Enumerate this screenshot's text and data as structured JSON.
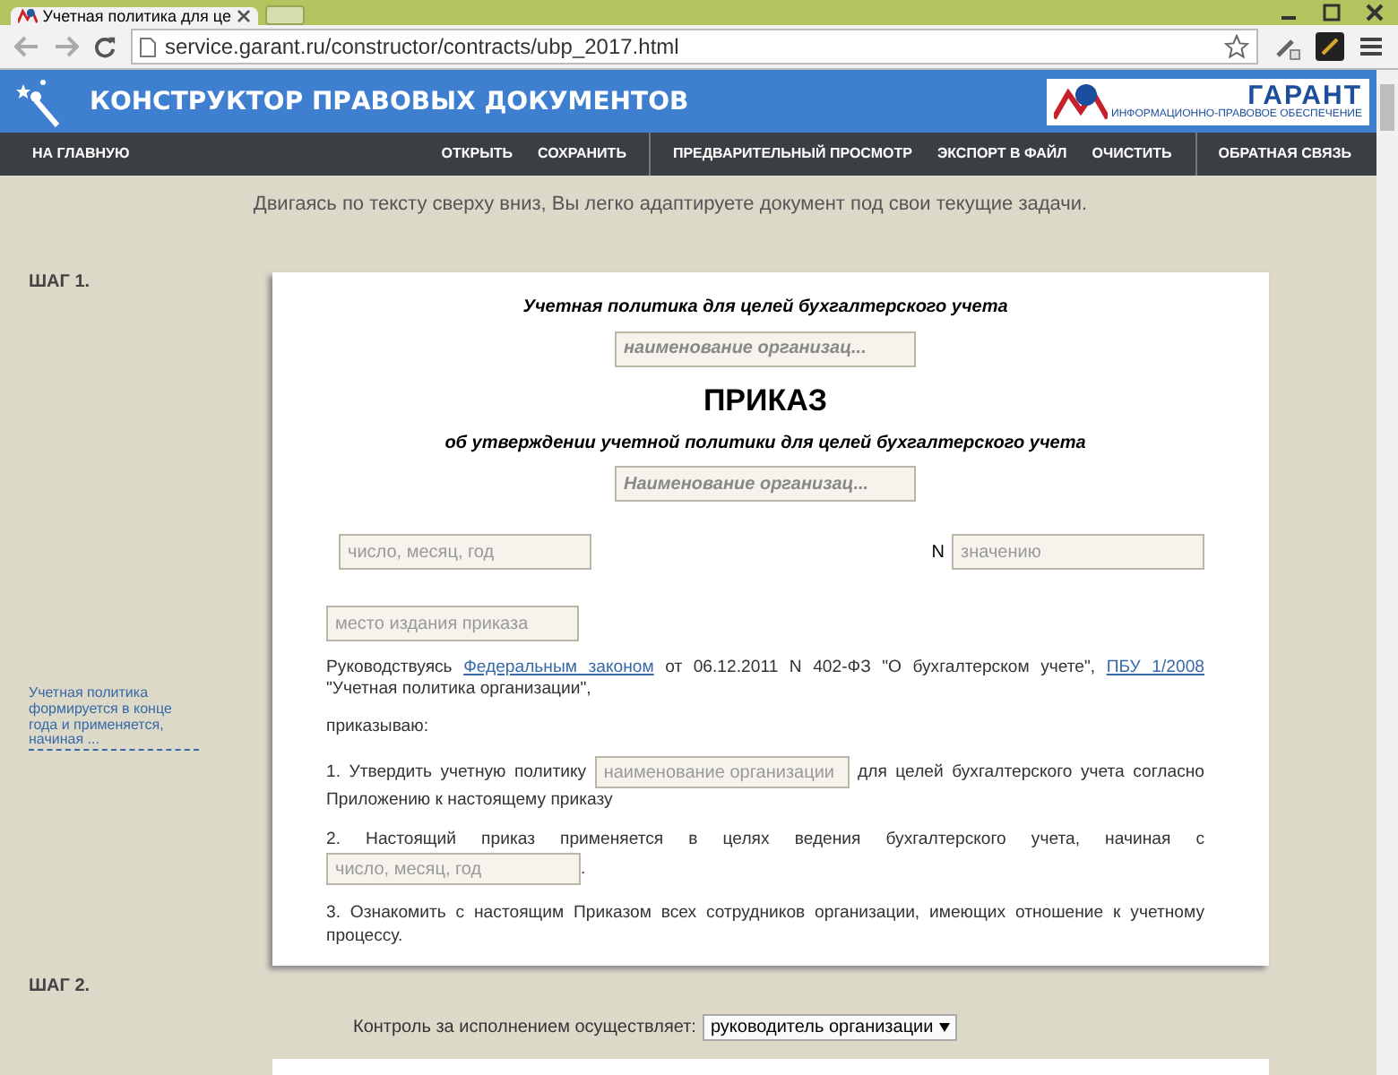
{
  "browser": {
    "tab_title": "Учетная политика для це",
    "url": "service.garant.ru/constructor/contracts/ubp_2017.html"
  },
  "header": {
    "title": "КОНСТРУКТОР ПРАВОВЫХ ДОКУМЕНТОВ",
    "logo_text": "ГАРАНТ",
    "logo_tagline": "ИНФОРМАЦИОННО-ПРАВОВОЕ ОБЕСПЕЧЕНИЕ"
  },
  "nav": [
    {
      "label": "НА ГЛАВНУЮ",
      "divider_before": false
    },
    {
      "label": "ОТКРЫТЬ",
      "divider_before": false
    },
    {
      "label": "СОХРАНИТЬ",
      "divider_before": false
    },
    {
      "label": "ПРЕДВАРИТЕЛЬНЫЙ ПРОСМОТР",
      "divider_before": true
    },
    {
      "label": "ЭКСПОРТ В ФАЙЛ",
      "divider_before": false
    },
    {
      "label": "ОЧИСТИТЬ",
      "divider_before": false
    },
    {
      "label": "ОБРАТНАЯ СВЯЗЬ",
      "divider_before": true
    }
  ],
  "intro": "Двигаясь по тексту сверху вниз, Вы легко адаптируете документ под свои текущие задачи.",
  "step1": {
    "label": "ШАГ 1.",
    "side_note": "Учетная политика формируется в конце года и применяется, начиная ...",
    "document": {
      "heading": "Учетная политика для целей бухгалтерского учета",
      "org_field": {
        "placeholder": "наименование организац..."
      },
      "title": "ПРИКАЗ",
      "subtitle": "об утверждении учетной политики для целей бухгалтерского учета",
      "org_field_2": {
        "placeholder": "Наименование организац..."
      },
      "date_field": {
        "placeholder": "число, месяц, год"
      },
      "number_label": "N",
      "number_field": {
        "placeholder": "значению"
      },
      "place_field": {
        "placeholder": "место издания приказа"
      },
      "preamble": [
        {
          "kind": "text",
          "text": "Руководствуясь "
        },
        {
          "kind": "link",
          "text": "Федеральным законом"
        },
        {
          "kind": "text",
          "text": " от 06.12.2011 N 402-ФЗ \"О бухгалтерском учете\", "
        },
        {
          "kind": "link",
          "text": "ПБУ 1/2008"
        },
        {
          "kind": "text",
          "text": " \"Учетная политика организации\","
        }
      ],
      "order_word": "приказываю:",
      "items": [
        [
          {
            "kind": "text",
            "text": "1. Утвердить учетную политику "
          },
          {
            "kind": "field",
            "placeholder": "наименование организации"
          },
          {
            "kind": "text",
            "text": " для целей бухгалтерского учета согласно Приложению к настоящему приказу"
          }
        ],
        [
          {
            "kind": "text",
            "text": "2. Настоящий приказ применяется в целях ведения бухгалтерского учета, начиная с "
          },
          {
            "kind": "field",
            "placeholder": "число, месяц, год"
          },
          {
            "kind": "text",
            "text": "."
          }
        ],
        [
          {
            "kind": "text",
            "text": "3. Ознакомить с настоящим Приказом всех сотрудников организации, имеющих отношение к учетному процессу."
          }
        ]
      ]
    }
  },
  "step2": {
    "label": "ШАГ 2.",
    "control_label": "Контроль за исполнением осуществляет:",
    "control_value": "руководитель организации"
  }
}
